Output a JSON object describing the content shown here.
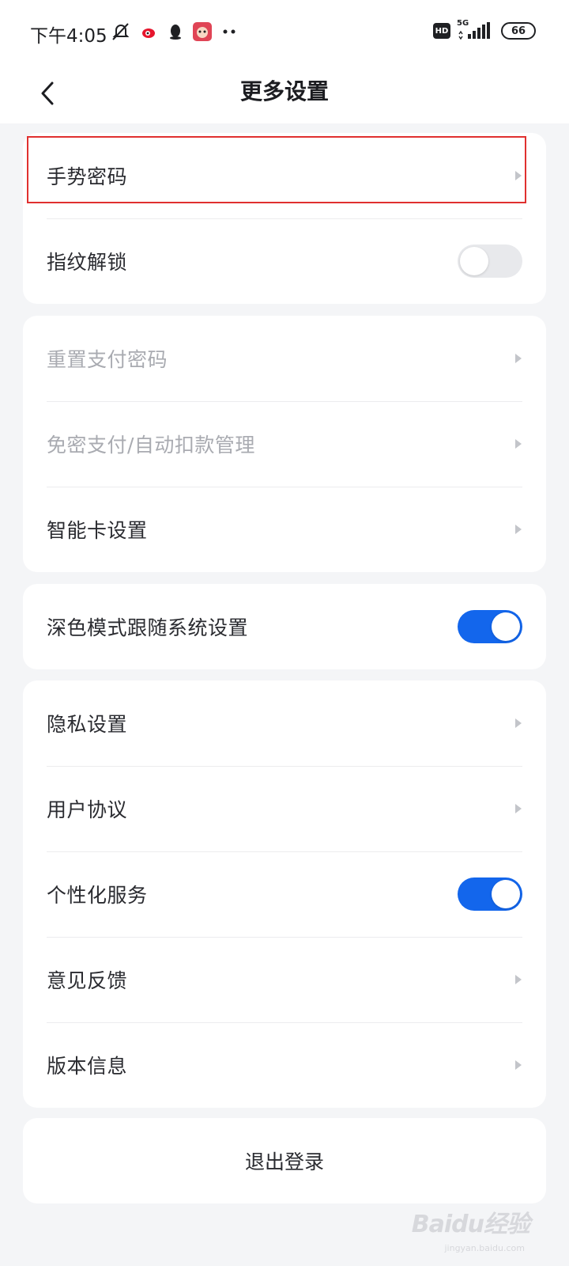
{
  "status_bar": {
    "time": "下午4:05",
    "hd_label": "HD",
    "network": "5G",
    "battery": "66"
  },
  "header": {
    "title": "更多设置"
  },
  "groups": [
    {
      "items": [
        {
          "label": "手势密码",
          "control": "chevron",
          "highlighted": true
        },
        {
          "label": "指纹解锁",
          "control": "toggle",
          "on": false
        }
      ]
    },
    {
      "items": [
        {
          "label": "重置支付密码",
          "control": "chevron",
          "disabled": true
        },
        {
          "label": "免密支付/自动扣款管理",
          "control": "chevron",
          "disabled": true
        },
        {
          "label": "智能卡设置",
          "control": "chevron"
        }
      ]
    },
    {
      "items": [
        {
          "label": "深色模式跟随系统设置",
          "control": "toggle",
          "on": true
        }
      ]
    },
    {
      "items": [
        {
          "label": "隐私设置",
          "control": "chevron"
        },
        {
          "label": "用户协议",
          "control": "chevron"
        },
        {
          "label": "个性化服务",
          "control": "toggle",
          "on": true
        },
        {
          "label": "意见反馈",
          "control": "chevron"
        },
        {
          "label": "版本信息",
          "control": "chevron"
        }
      ]
    }
  ],
  "logout": {
    "label": "退出登录"
  },
  "watermark": {
    "main": "Baidu经验",
    "sub": "jingyan.baidu.com"
  },
  "colors": {
    "accent": "#1366ec",
    "highlight": "#e0302f",
    "background": "#f4f5f7"
  }
}
